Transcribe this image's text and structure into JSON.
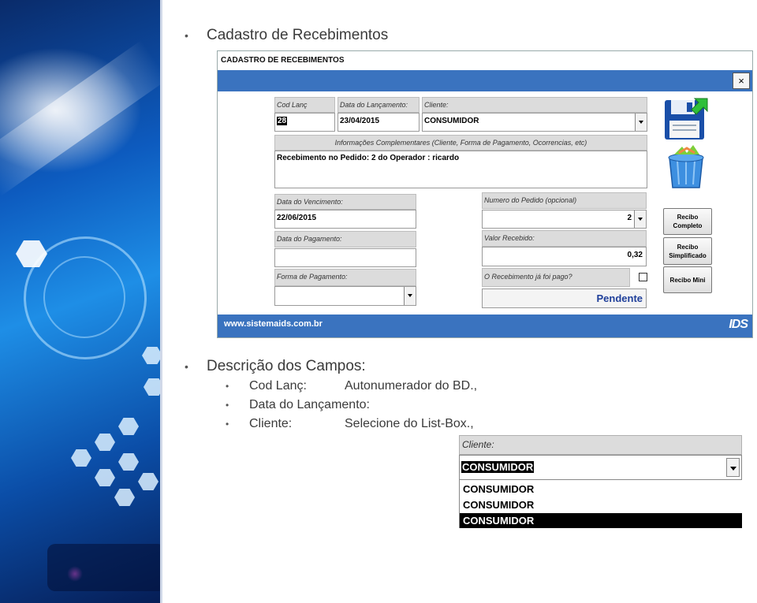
{
  "slide": {
    "bullet1": "Cadastro de Recebimentos",
    "bullet2": "Descrição dos Campos:",
    "fields": [
      {
        "name": "Cod Lanç:",
        "desc": "Autonumerador do BD.,"
      },
      {
        "name": "Data do Lançamento:",
        "desc": ""
      },
      {
        "name": "Cliente:",
        "desc": "Selecione do List-Box.,"
      }
    ]
  },
  "form": {
    "title": "CADASTRO DE RECEBIMENTOS",
    "close": "×",
    "labels": {
      "cod": "Cod Lanç",
      "data_lanc": "Data do Lançamento:",
      "cliente": "Cliente:",
      "info": "Informações Complementares (Cliente, Forma de Pagamento, Ocorrencias,  etc)",
      "vencimento": "Data do Vencimento:",
      "pedido": "Numero do Pedido (opcional)",
      "pagamento": "Data do Pagamento:",
      "valor": "Valor Recebido:",
      "forma": "Forma de Pagamento:",
      "pago": "O Recebimento já foi pago?"
    },
    "values": {
      "cod": "28",
      "data_lanc": "23/04/2015",
      "cliente": "CONSUMIDOR",
      "info": "Recebimento no Pedido: 2 do Operador : ricardo",
      "vencimento": "22/06/2015",
      "pedido": "2",
      "pagamento": "",
      "valor": "0,32",
      "forma": "",
      "status": "Pendente"
    },
    "buttons": {
      "recibo_completo": "Recibo Completo",
      "recibo_simplificado": "Recibo Simplificado",
      "recibo_mini": "Recibo Mini"
    },
    "footer_site": "www.sistemaids.com.br",
    "footer_logo": "IDS",
    "status_color": "#1f3f9a",
    "band_color": "#3a73bf"
  },
  "zoom": {
    "label": "Cliente:",
    "value": "CONSUMIDOR",
    "options": [
      "CONSUMIDOR",
      "CONSUMIDOR",
      "CONSUMIDOR"
    ],
    "selected_index": 2
  }
}
